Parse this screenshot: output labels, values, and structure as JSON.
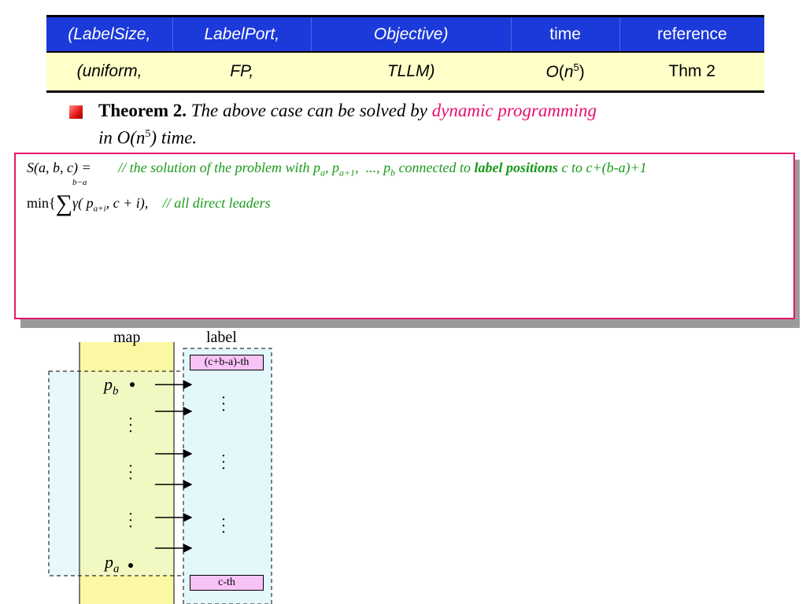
{
  "table": {
    "headers": [
      "(LabelSize,",
      "LabelPort,",
      "Objective)",
      "time",
      "reference"
    ],
    "row": [
      "(uniform,",
      "FP,",
      "TLLM)",
      "O(n5)",
      "Thm 2"
    ]
  },
  "theorem": {
    "label": "Theorem 2.",
    "text_before": "The above case can be solved by",
    "highlight": "dynamic programming",
    "text_line2_a": "in O(n",
    "sup": "5",
    "text_line2_b": ") time."
  },
  "recurrence": {
    "lhs": "S(a, b, c) =",
    "comment1_a": "// the solution of the problem with p",
    "comment1_bold": "label positions",
    "comment1_b": "c to c+(b-a)+1",
    "min_text": "min{",
    "sum_upper": "b−a",
    "term": "γ( p",
    "term_sub": "a+i",
    "term_rest": ", c + i),",
    "comment2": "// all direct leaders"
  },
  "diagram": {
    "map_label": "map",
    "label_label": "label",
    "top_tag": "(c+b-a)-th",
    "bottom_tag": "c-th",
    "p_top": "p",
    "p_top_sub": "b",
    "p_bottom": "p",
    "p_bottom_sub": "a"
  },
  "colors": {
    "header_bg": "#1c39d9",
    "row_bg": "#ffffc9",
    "accent_pink": "#e8106e",
    "comment_green": "#1a9a1a",
    "map_strip": "#fbf8a3",
    "label_region": "#e3f8fb",
    "tag_fill": "#f7c3f7"
  }
}
